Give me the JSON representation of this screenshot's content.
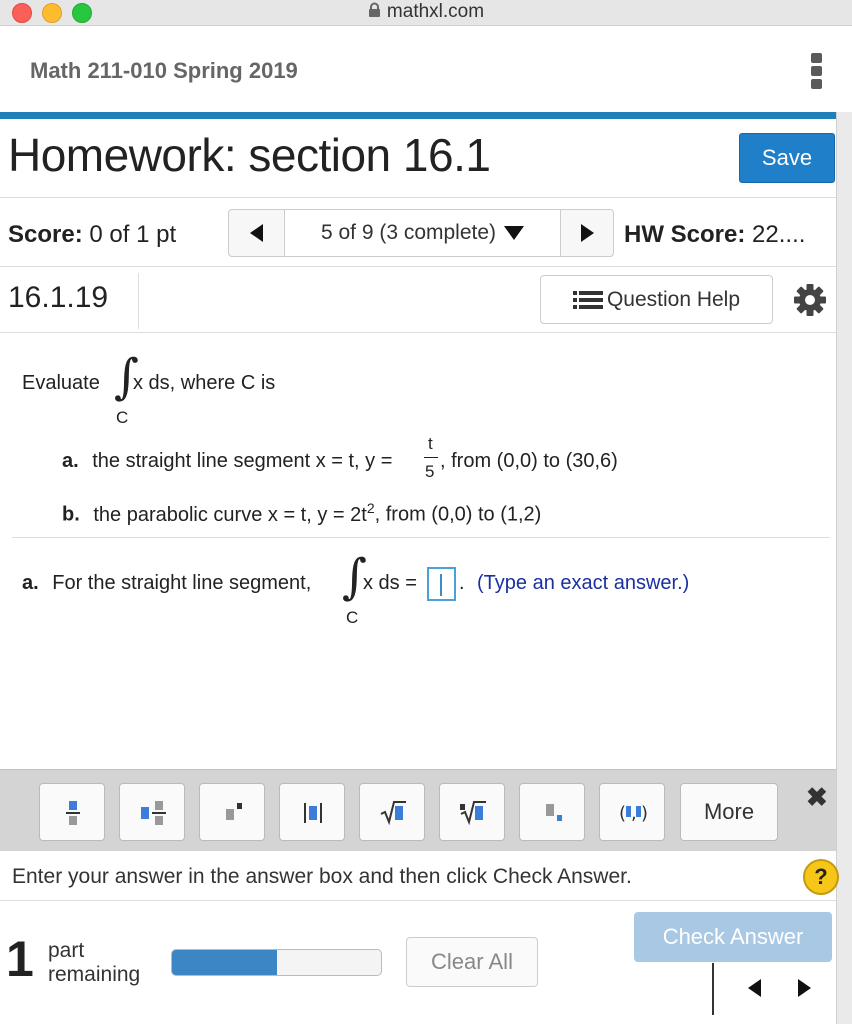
{
  "browser": {
    "url": "mathxl.com"
  },
  "course": {
    "title": "Math 211-010 Spring 2019"
  },
  "homework": {
    "title": "Homework: section 16.1",
    "save_label": "Save"
  },
  "score": {
    "label": "Score:",
    "value": "0 of 1 pt"
  },
  "navigator": {
    "position": "5 of 9 (3 complete)"
  },
  "hw_score": {
    "label": "HW Score:",
    "value": "22...."
  },
  "question": {
    "number": "16.1.19",
    "help_label": "Question Help"
  },
  "problem": {
    "evaluate": "Evaluate",
    "integrand": "x ds, where C is",
    "contour": "C",
    "part_a_letter": "a.",
    "part_a_text": "the straight line segment x = t, y =",
    "frac_num": "t",
    "frac_den": "5",
    "part_a_tail": ", from (0,0) to (30,6)",
    "part_b_letter": "b.",
    "part_b_text": "the parabolic curve x = t, y = 2t",
    "part_b_exp": "2",
    "part_b_tail": ", from (0,0) to (1,2)"
  },
  "answer": {
    "letter": "a.",
    "prompt": "For the straight line segment,",
    "expr": "x ds =",
    "contour": "C",
    "period": ".",
    "instruction": "(Type an exact answer.)",
    "value": ""
  },
  "toolbar": {
    "buttons": [
      "fraction-icon",
      "mixed-number-icon",
      "exponent-icon",
      "absolute-value-icon",
      "square-root-icon",
      "nth-root-icon",
      "subscript-icon",
      "ordered-pair-icon"
    ],
    "more_label": "More",
    "close_symbol": "✖"
  },
  "hint": {
    "text": "Enter your answer in the answer box and then click Check Answer.",
    "help_symbol": "?"
  },
  "footer": {
    "parts_remaining": "1",
    "parts_word": "part",
    "remaining_word": "remaining",
    "progress_fraction": 0.5,
    "clear_label": "Clear All",
    "check_label": "Check Answer"
  },
  "colors": {
    "accent": "#1f7fc8",
    "bar": "#1f7fb8",
    "instruction": "#1a2fa0"
  }
}
